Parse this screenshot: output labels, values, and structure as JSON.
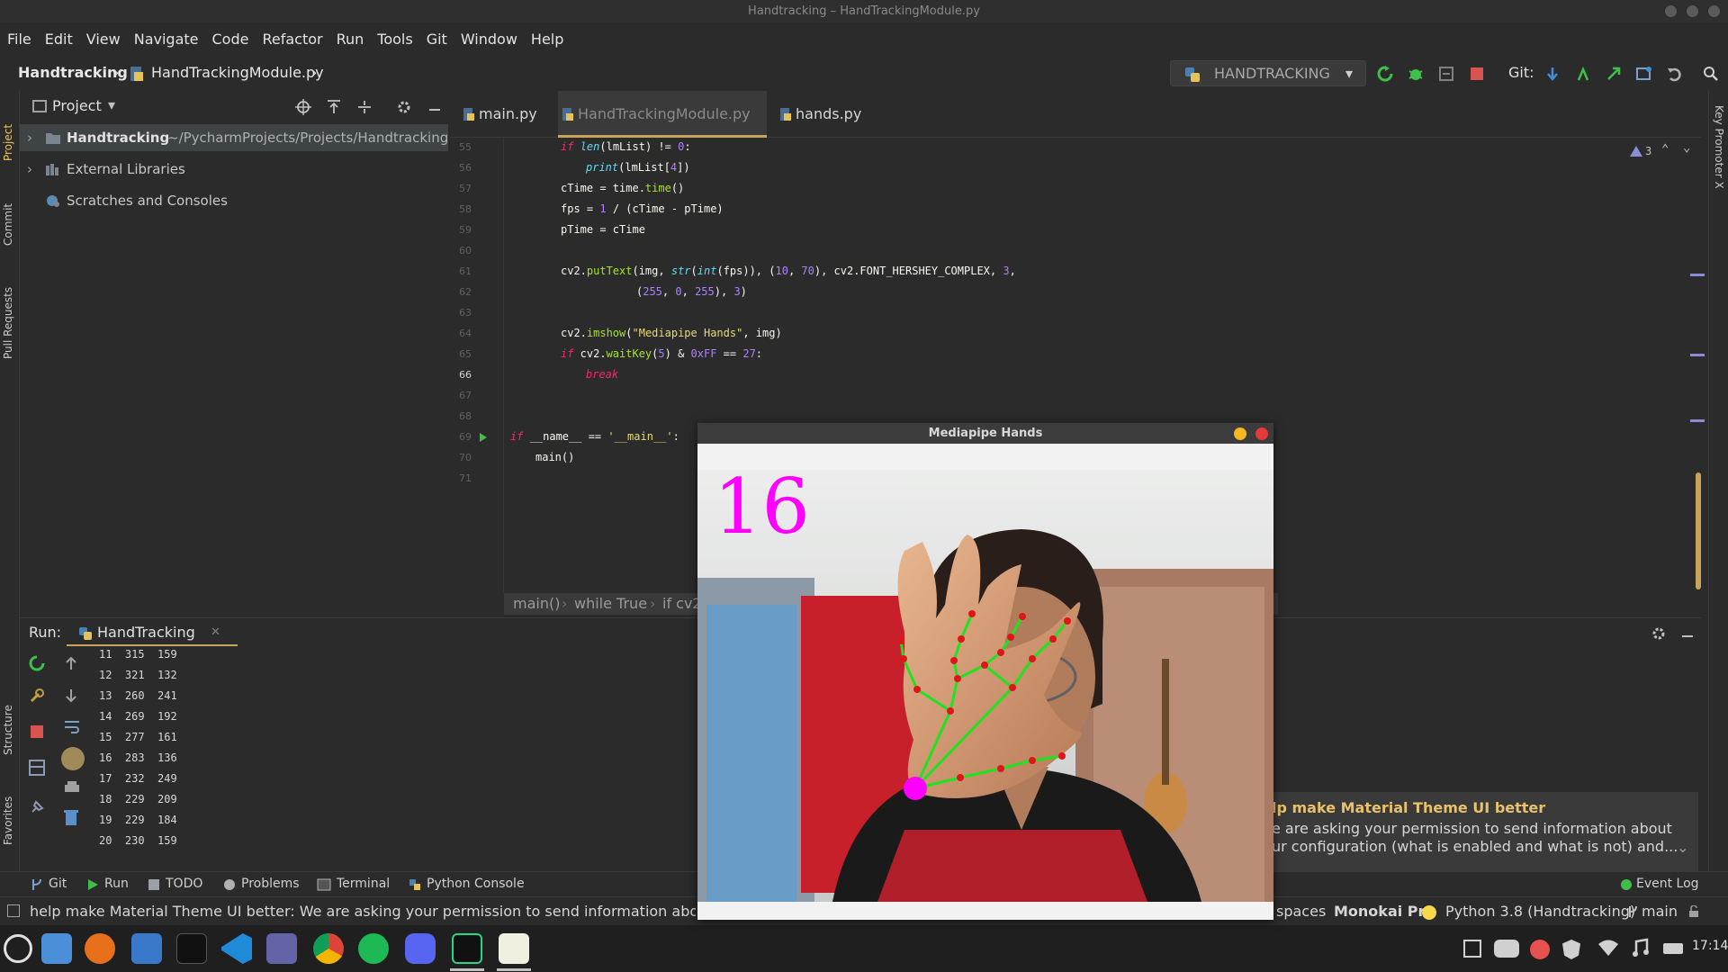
{
  "window": {
    "title": "Handtracking – HandTrackingModule.py"
  },
  "menu": [
    "File",
    "Edit",
    "View",
    "Navigate",
    "Code",
    "Refactor",
    "Run",
    "Tools",
    "Git",
    "Window",
    "Help"
  ],
  "nav": {
    "project": "Handtracking",
    "file": "HandTrackingModule.py",
    "run_config": "HANDTRACKING",
    "git_label": "Git:"
  },
  "left_tabs": [
    "Project",
    "Commit",
    "Pull Requests",
    "Structure",
    "Favorites"
  ],
  "right_tabs": [
    "Key Promoter X"
  ],
  "project_panel": {
    "title": "Project",
    "tree": [
      {
        "name": "Handtracking",
        "path": "~/PycharmProjects/Projects/Handtracking"
      },
      {
        "name": "External Libraries",
        "path": ""
      },
      {
        "name": "Scratches and Consoles",
        "path": ""
      }
    ]
  },
  "tabs": [
    "main.py",
    "HandTrackingModule.py",
    "hands.py"
  ],
  "editor": {
    "warnings": "3",
    "line_numbers": [
      "55",
      "56",
      "57",
      "58",
      "59",
      "60",
      "61",
      "62",
      "63",
      "64",
      "65",
      "66",
      "67",
      "68",
      "69",
      "70",
      "71"
    ],
    "breadcrumb": [
      "main()",
      "while True",
      "if cv2"
    ]
  },
  "run_panel": {
    "label": "Run:",
    "tab": "HandTracking",
    "output": [
      [
        "11",
        "315",
        "159"
      ],
      [
        "12",
        "321",
        "132"
      ],
      [
        "13",
        "260",
        "241"
      ],
      [
        "14",
        "269",
        "192"
      ],
      [
        "15",
        "277",
        "161"
      ],
      [
        "16",
        "283",
        "136"
      ],
      [
        "17",
        "232",
        "249"
      ],
      [
        "18",
        "229",
        "209"
      ],
      [
        "19",
        "229",
        "184"
      ],
      [
        "20",
        "230",
        "159"
      ]
    ]
  },
  "tool_buttons": [
    "Git",
    "Run",
    "TODO",
    "Problems",
    "Terminal",
    "Python Console",
    "Event Log"
  ],
  "cv_window": {
    "title": "Mediapipe Hands",
    "fps": "16"
  },
  "notification": {
    "title": "lp make Material Theme UI better",
    "line1": "e are asking your permission to send information about",
    "line2": "ur configuration (what is enabled and what is not) and..."
  },
  "status": {
    "message": "help make Material Theme UI better: We are asking your permission to send information about your con",
    "indent": "spaces",
    "theme": "Monokai Pro",
    "interpreter": "Python 3.8 (Handtracking)",
    "branch": "main"
  },
  "taskbar": {
    "time": "17:14"
  },
  "colors": {
    "accent": "#c8a35a",
    "keyword": "#f92672",
    "function": "#a6e22e",
    "number": "#ae81ff",
    "string": "#e6db74",
    "landmark": "#e0151b",
    "connection": "#1ee31e",
    "fps_text": "#ff00ff"
  }
}
